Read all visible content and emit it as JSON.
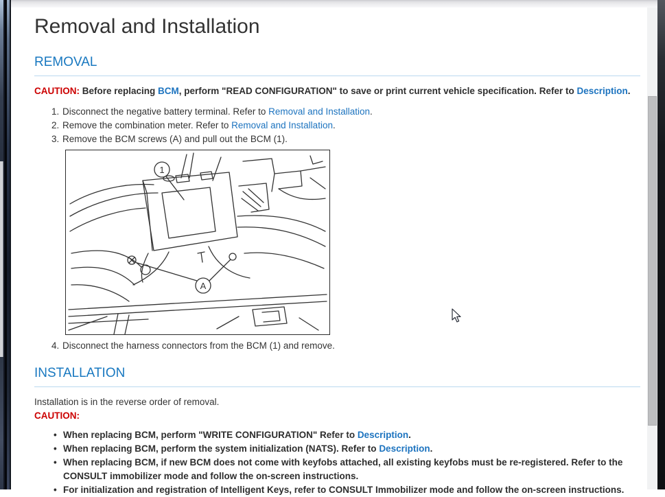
{
  "colors": {
    "section_heading": "#1878c0",
    "link": "#1c73bf",
    "caution_red": "#cc0000",
    "body_text": "#333333",
    "rule_blue": "#b9d8ef"
  },
  "page": {
    "title": "Removal and Installation",
    "removal": {
      "heading": "REMOVAL",
      "caution": {
        "label": "CAUTION:",
        "before": " Before replacing ",
        "link_bcm": "BCM",
        "middle": ", perform \"READ CONFIGURATION\" to save or print current vehicle specification. Refer to ",
        "link_desc": "Description",
        "end": "."
      },
      "steps": [
        {
          "num": "1.",
          "text": "Disconnect the negative battery terminal. Refer to ",
          "link": "Removal and Installation",
          "after": "."
        },
        {
          "num": "2.",
          "text": "Remove the combination meter. Refer to ",
          "link": "Removal and Installation",
          "after": "."
        },
        {
          "num": "3.",
          "text": "Remove the BCM screws (A) and pull out the BCM (1).",
          "link": "",
          "after": ""
        },
        {
          "num": "4.",
          "text": "Disconnect the harness connectors from the BCM (1) and remove.",
          "link": "",
          "after": ""
        }
      ],
      "figure": {
        "description": "BCM location line drawing",
        "callout_1": "1",
        "callout_a": "A"
      }
    },
    "installation": {
      "heading": "INSTALLATION",
      "intro": "Installation is in the reverse order of removal.",
      "caution_label": "CAUTION:",
      "bullets": [
        {
          "text": "When replacing BCM, perform \"WRITE CONFIGURATION\" Refer to ",
          "link": "Description",
          "after": "."
        },
        {
          "text": "When replacing BCM, perform the system initialization (NATS). Refer to ",
          "link": "Description",
          "after": "."
        },
        {
          "text": "When replacing BCM, if new BCM does not come with keyfobs attached, all existing keyfobs must be re-registered. Refer to the CONSULT immobilizer mode and follow the on-screen instructions.",
          "link": "",
          "after": ""
        },
        {
          "text": "For initialization and registration of Intelligent Keys, refer to CONSULT Immobilizer mode and follow the on-screen instructions.",
          "link": "",
          "after": ""
        }
      ]
    }
  }
}
